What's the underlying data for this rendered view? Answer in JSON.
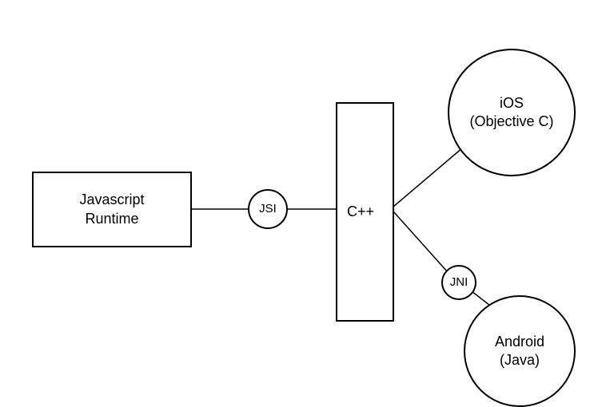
{
  "nodes": {
    "js_runtime": {
      "label": "Javascript\nRuntime"
    },
    "jsi": {
      "label": "JSI"
    },
    "cpp": {
      "label": "C++"
    },
    "ios": {
      "label": "iOS\n(Objective C)"
    },
    "jni": {
      "label": "JNI"
    },
    "android": {
      "label": "Android\n(Java)"
    }
  },
  "edges": [
    {
      "from": "js_runtime",
      "to": "jsi"
    },
    {
      "from": "jsi",
      "to": "cpp"
    },
    {
      "from": "cpp",
      "to": "ios"
    },
    {
      "from": "cpp",
      "to": "jni"
    },
    {
      "from": "jni",
      "to": "android"
    }
  ]
}
